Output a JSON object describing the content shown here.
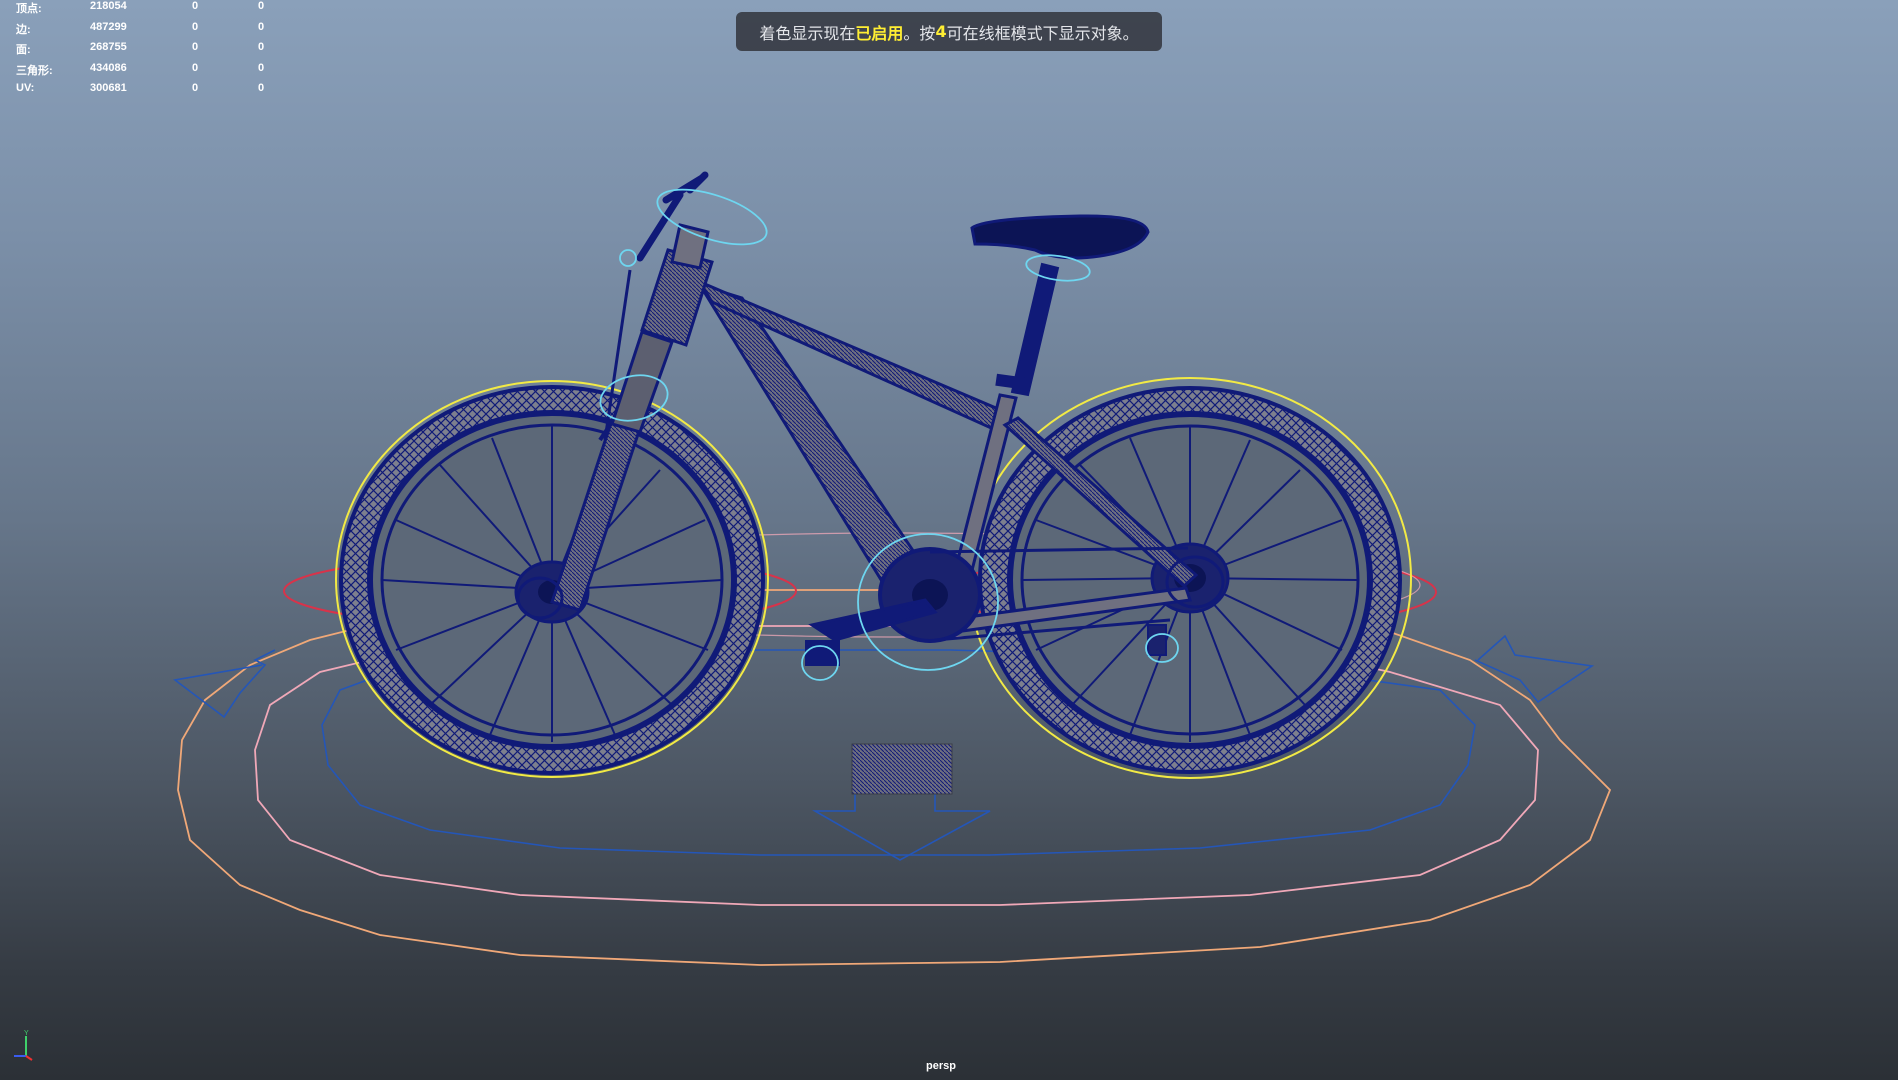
{
  "hud": {
    "rows": [
      {
        "label": "顶点:",
        "v1": "218054",
        "v2": "0",
        "v3": "0"
      },
      {
        "label": "边:",
        "v1": "487299",
        "v2": "0",
        "v3": "0"
      },
      {
        "label": "面:",
        "v1": "268755",
        "v2": "0",
        "v3": "0"
      },
      {
        "label": "三角形:",
        "v1": "434086",
        "v2": "0",
        "v3": "0"
      },
      {
        "label": "UV:",
        "v1": "300681",
        "v2": "0",
        "v3": "0"
      }
    ]
  },
  "notice": {
    "part1": "着色显示现在",
    "highlight1": "已启用",
    "part2": "。按 ",
    "highlight2": "4",
    "part3": " 可在线框模式下显示对象。"
  },
  "camera": {
    "label": "persp"
  },
  "axis_gizmo": {
    "y_label": "Y"
  },
  "colors": {
    "wire": "#101a78",
    "control_yellow": "#f2ea45",
    "control_red": "#d8334a",
    "control_cyan": "#6ed6f0",
    "control_blue": "#2456b8",
    "control_pink": "#f0a8b8",
    "control_orange": "#f0a878"
  }
}
